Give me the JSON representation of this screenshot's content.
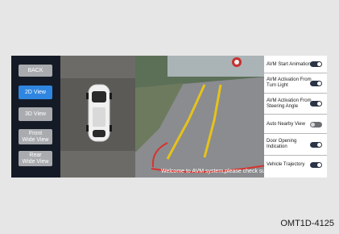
{
  "nav": {
    "back": "BACK",
    "view_2d": "2D View",
    "view_3d": "3D View",
    "front_wide": "Front\nWide View",
    "rear_wide": "Rear\nWide View"
  },
  "message": "Welcome to AVM system,please check surroundings!",
  "settings": [
    {
      "label": "AVM Start Animation",
      "state": "on"
    },
    {
      "label": "AVM Activation From\nTurn Light",
      "state": "on"
    },
    {
      "label": "AVM Activation From\nSteering Angle",
      "state": "on"
    },
    {
      "label": "Auto Nearby View",
      "state": "off"
    },
    {
      "label": "Door Opening\nIndication",
      "state": "on"
    },
    {
      "label": "Vehicle Trajectory",
      "state": "on"
    }
  ],
  "doc_code": "OMT1D-4125",
  "colors": {
    "active": "#2f86e0",
    "inactive": "#a9abaf",
    "nav_bg": "#151b26",
    "trajectory_red": "#d8322d",
    "guide_yellow": "#e7c21a"
  }
}
